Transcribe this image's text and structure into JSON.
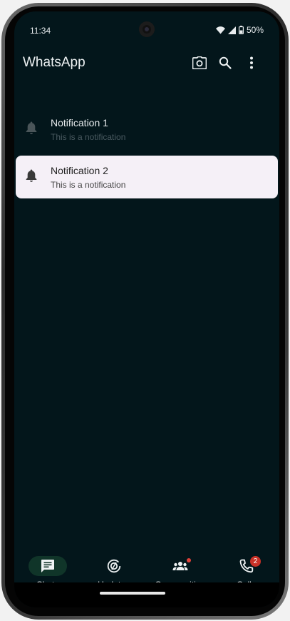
{
  "status_bar": {
    "time": "11:34",
    "battery": "50%",
    "icons": [
      "wifi-icon",
      "signal-icon",
      "battery-icon"
    ]
  },
  "app_bar": {
    "title": "WhatsApp",
    "actions": [
      "camera-icon",
      "search-icon",
      "more-vert-icon"
    ]
  },
  "notifications": [
    {
      "title": "Notification 1",
      "body": "This is a notification",
      "icon": "bell-icon",
      "selected": false
    },
    {
      "title": "Notification 2",
      "body": "This is a notification",
      "icon": "bell-icon",
      "selected": true
    }
  ],
  "bottom_nav": {
    "items": [
      {
        "label": "Chats",
        "icon": "chat-icon",
        "active": true
      },
      {
        "label": "Updates",
        "icon": "updates-icon",
        "active": false,
        "dot": false
      },
      {
        "label": "Communities",
        "icon": "communities-icon",
        "active": false,
        "dot": true
      },
      {
        "label": "Calls",
        "icon": "phone-icon",
        "active": false,
        "badge": "2"
      }
    ]
  },
  "colors": {
    "background": "#03161b",
    "active_pill": "#103529",
    "badge": "#c93127",
    "selected_card": "#f5f0f7"
  }
}
